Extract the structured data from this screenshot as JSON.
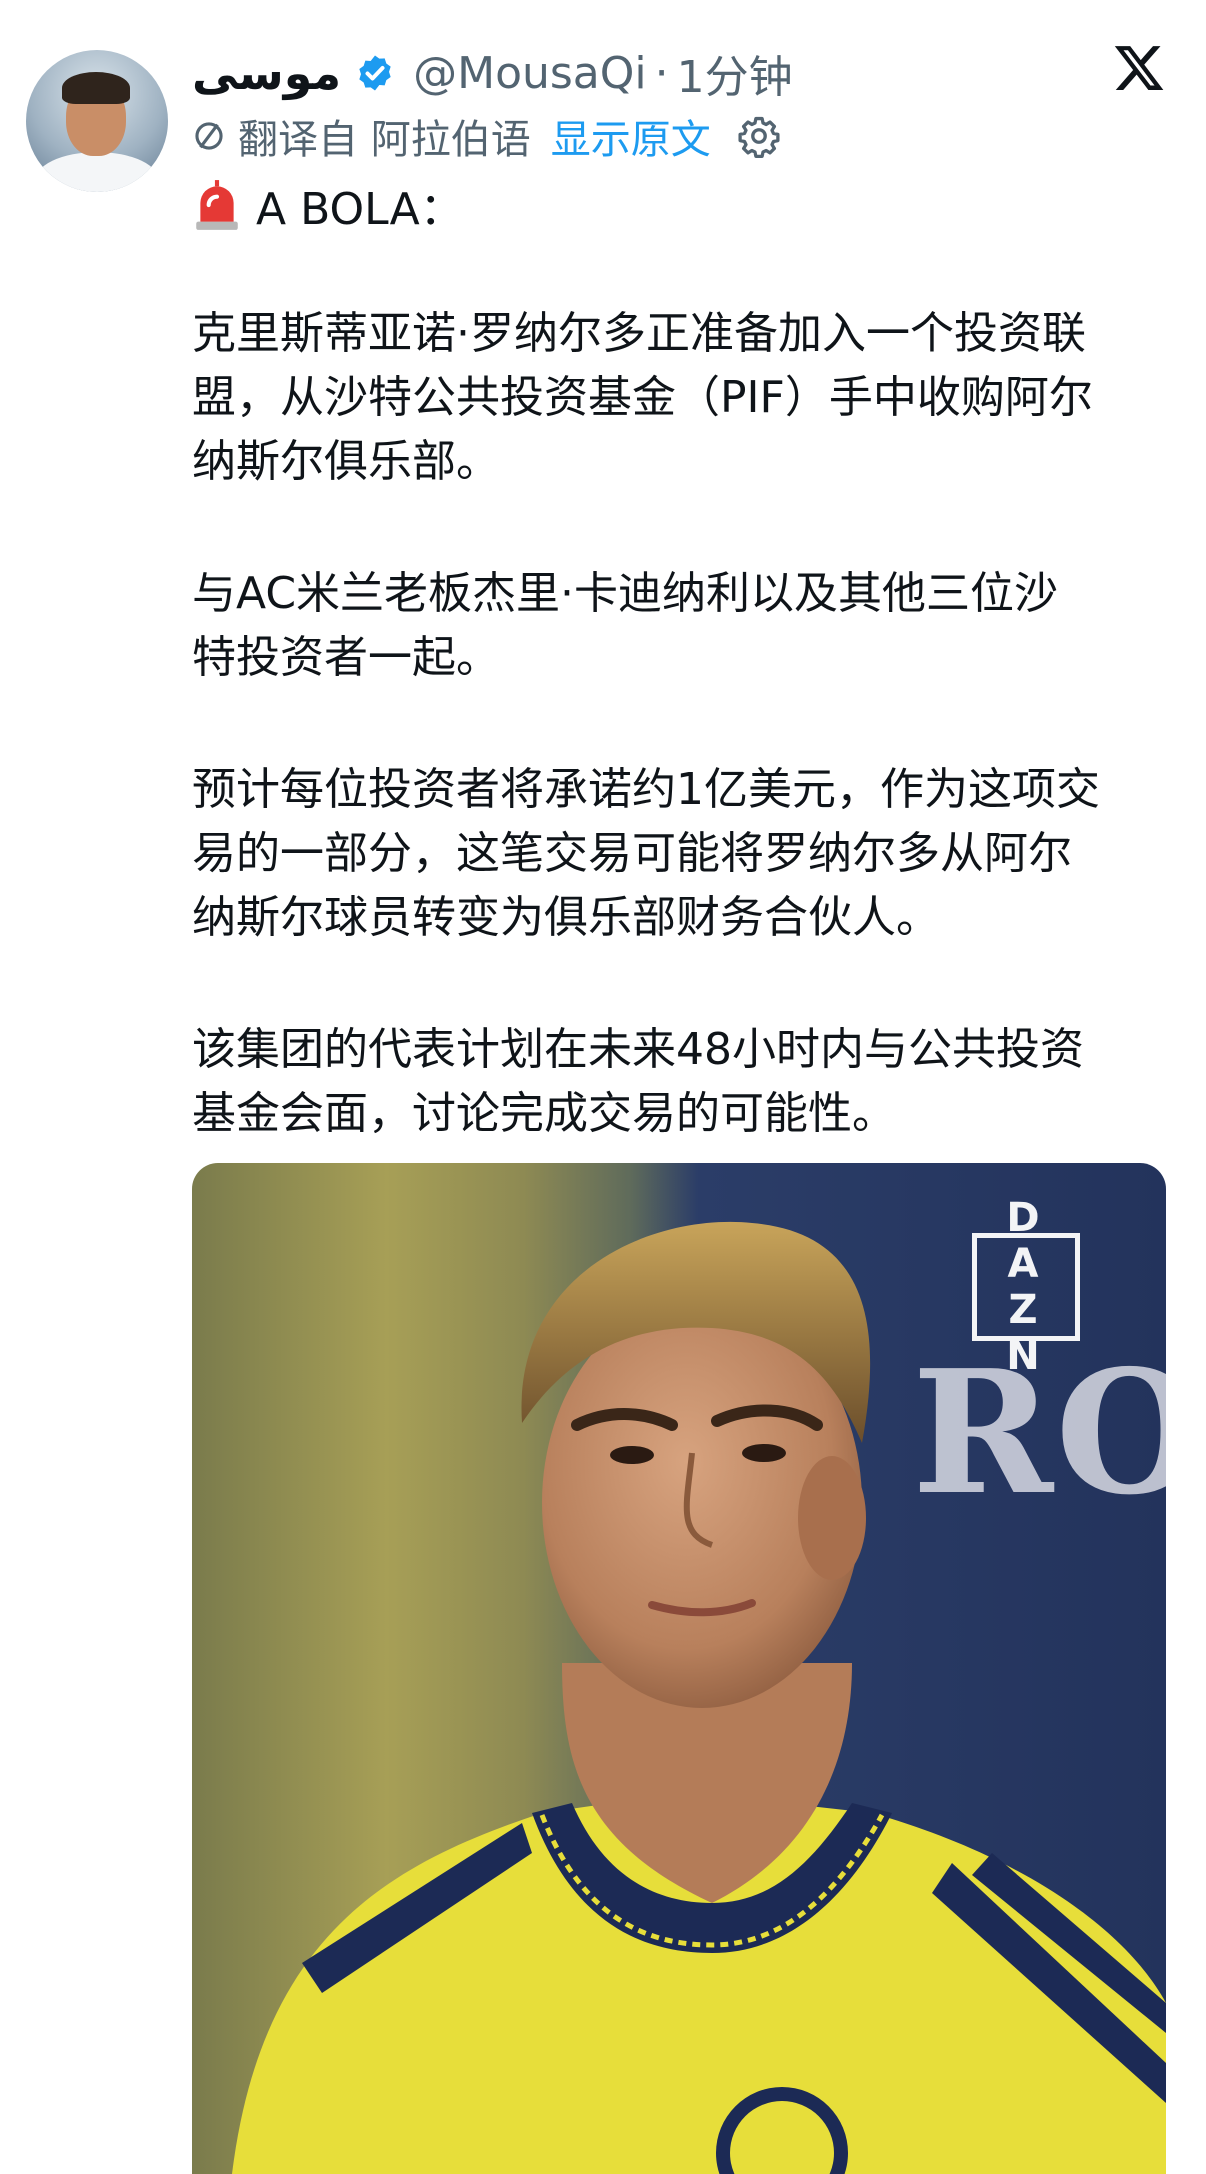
{
  "tweet": {
    "author_name": "موسى",
    "handle": "@MousaQi",
    "separator": "·",
    "time": "1分钟",
    "translation": {
      "translated_from": "翻译自 阿拉伯语",
      "show_original": "显示原文"
    },
    "source_label": "A BOLA：",
    "paragraphs": [
      {
        "lines": [
          "克里斯蒂亚诺·罗纳尔多正准备加入一个投资联",
          "盟，从沙特公共投资基金（PIF）手中收购阿尔",
          "纳斯尔俱乐部。"
        ]
      },
      {
        "lines": [
          "与AC米兰老板杰里·卡迪纳利以及其他三位沙",
          "特投资者一起。"
        ]
      },
      {
        "lines": [
          "预计每位投资者将承诺约1亿美元，作为这项交",
          "易的一部分，这笔交易可能将罗纳尔多从阿尔",
          "纳斯尔球员转变为俱乐部财务合伙人。"
        ]
      },
      {
        "lines": [
          "该集团的代表计划在未来48小时内与公共投资",
          "基金会面，讨论完成交易的可能性。"
        ]
      }
    ],
    "media": {
      "watermark": "DAZN",
      "background_text": "ROS"
    }
  },
  "icons": {
    "verified": "verified-badge-icon",
    "x_logo": "x-logo-icon",
    "translate": "translate-icon",
    "settings": "gear-icon",
    "alert": "police-siren-icon"
  },
  "colors": {
    "text_primary": "#0f1419",
    "text_secondary": "#536471",
    "link": "#1d9bf0",
    "verified": "#1d9bf0",
    "jersey_yellow": "#e7de3a",
    "jersey_navy": "#1c2a55"
  }
}
